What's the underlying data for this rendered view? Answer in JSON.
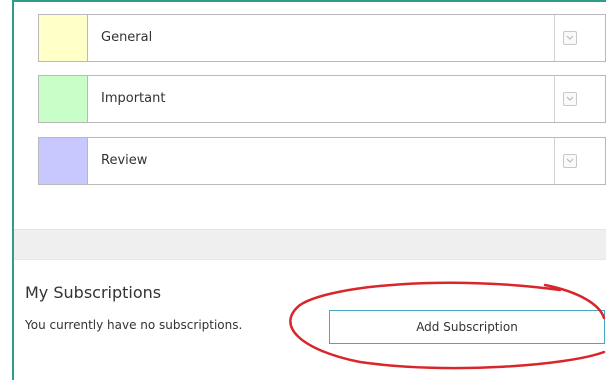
{
  "categories": [
    {
      "label": "General",
      "color": "#ffffc8"
    },
    {
      "label": "Important",
      "color": "#c8ffc8"
    },
    {
      "label": "Review",
      "color": "#c8c8ff"
    }
  ],
  "subscriptions": {
    "title": "My Subscriptions",
    "empty_message": "You currently have no subscriptions.",
    "add_button_label": "Add Subscription"
  },
  "colors": {
    "frame_border": "#2e9d8c",
    "annotation_circle": "#d9262b",
    "button_border": "#46a8c4"
  }
}
